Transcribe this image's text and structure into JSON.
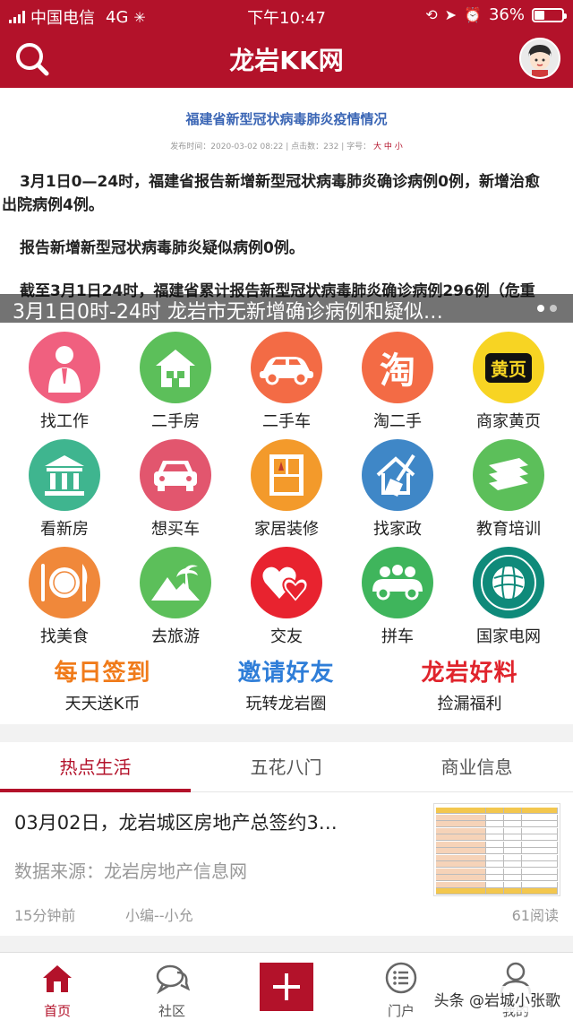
{
  "status_bar": {
    "carrier": "中国电信",
    "network": "4G",
    "time": "下午10:47",
    "battery_percent": "36%",
    "battery_level": 0.36
  },
  "header": {
    "title": "龙岩KK网",
    "search_icon": "search-icon",
    "avatar_icon": "user-avatar"
  },
  "banner": {
    "doc_title": "福建省新型冠状病毒肺炎疫情情况",
    "doc_meta": "发布时间：2020-03-02 08:22 | 点击数：232 | 字号：",
    "doc_meta_size": "大 中 小",
    "doc_lines": [
      "3月1日0—24时，福建省报告新增新型冠状病毒肺炎确诊病例0例，新增治愈",
      "出院病例4例。",
      "报告新增新型冠状病毒肺炎疑似病例0例。",
      "截至3月1日24时，福建省累计报告新型冠状病毒肺炎确诊病例296例（危重"
    ],
    "caption": "3月1日0时-24时 龙岩市无新增确诊病例和疑似…",
    "slide_count": 2,
    "active_slide": 0
  },
  "categories": [
    {
      "label": "找工作",
      "icon": "job-person-icon",
      "color": "#f0607f"
    },
    {
      "label": "二手房",
      "icon": "house-icon",
      "color": "#5cbf5a"
    },
    {
      "label": "二手车",
      "icon": "car-icon",
      "color": "#f36b45"
    },
    {
      "label": "淘二手",
      "icon": "tao-icon",
      "color": "#f36b45"
    },
    {
      "label": "商家黄页",
      "icon": "yellow-pages-icon",
      "color": "#f7d423"
    },
    {
      "label": "看新房",
      "icon": "building-icon",
      "color": "#3fb58f"
    },
    {
      "label": "想买车",
      "icon": "car-front-icon",
      "color": "#e2566e"
    },
    {
      "label": "家居装修",
      "icon": "furniture-icon",
      "color": "#f39a2b"
    },
    {
      "label": "找家政",
      "icon": "broom-house-icon",
      "color": "#3f87c7"
    },
    {
      "label": "教育培训",
      "icon": "books-icon",
      "color": "#5cbf5a"
    },
    {
      "label": "找美食",
      "icon": "plate-icon",
      "color": "#f0883a"
    },
    {
      "label": "去旅游",
      "icon": "palm-mountain-icon",
      "color": "#5cbf5a"
    },
    {
      "label": "交友",
      "icon": "hearts-icon",
      "color": "#e8232f"
    },
    {
      "label": "拼车",
      "icon": "carpool-icon",
      "color": "#3fb55c"
    },
    {
      "label": "国家电网",
      "icon": "state-grid-logo-icon",
      "color": "#0f8a7a"
    }
  ],
  "promos": [
    {
      "title": "每日签到",
      "subtitle": "天天送K币",
      "color": "#f07b1a"
    },
    {
      "title": "邀请好友",
      "subtitle": "玩转龙岩圈",
      "color": "#2f7ed8"
    },
    {
      "title": "龙岩好料",
      "subtitle": "捡漏福利",
      "color": "#e0242c"
    }
  ],
  "tabs": [
    "热点生活",
    "五花八门",
    "商业信息"
  ],
  "active_tab": 0,
  "article": {
    "title": "03月02日，龙岩城区房地产总签约3…",
    "source": "数据来源：龙岩房地产信息网",
    "time": "15分钟前",
    "author": "小编--小允",
    "reads": "61阅读"
  },
  "bottom_nav": [
    {
      "label": "首页",
      "icon": "home-icon"
    },
    {
      "label": "社区",
      "icon": "chat-bubbles-icon"
    },
    {
      "label": "",
      "icon": "plus-icon"
    },
    {
      "label": "门户",
      "icon": "portal-list-icon"
    },
    {
      "label": "我的",
      "icon": "person-icon"
    }
  ],
  "watermark": "头条 @岩城小张歌",
  "colors": {
    "brand": "#b3122a",
    "text": "#222222",
    "muted": "#999999"
  }
}
